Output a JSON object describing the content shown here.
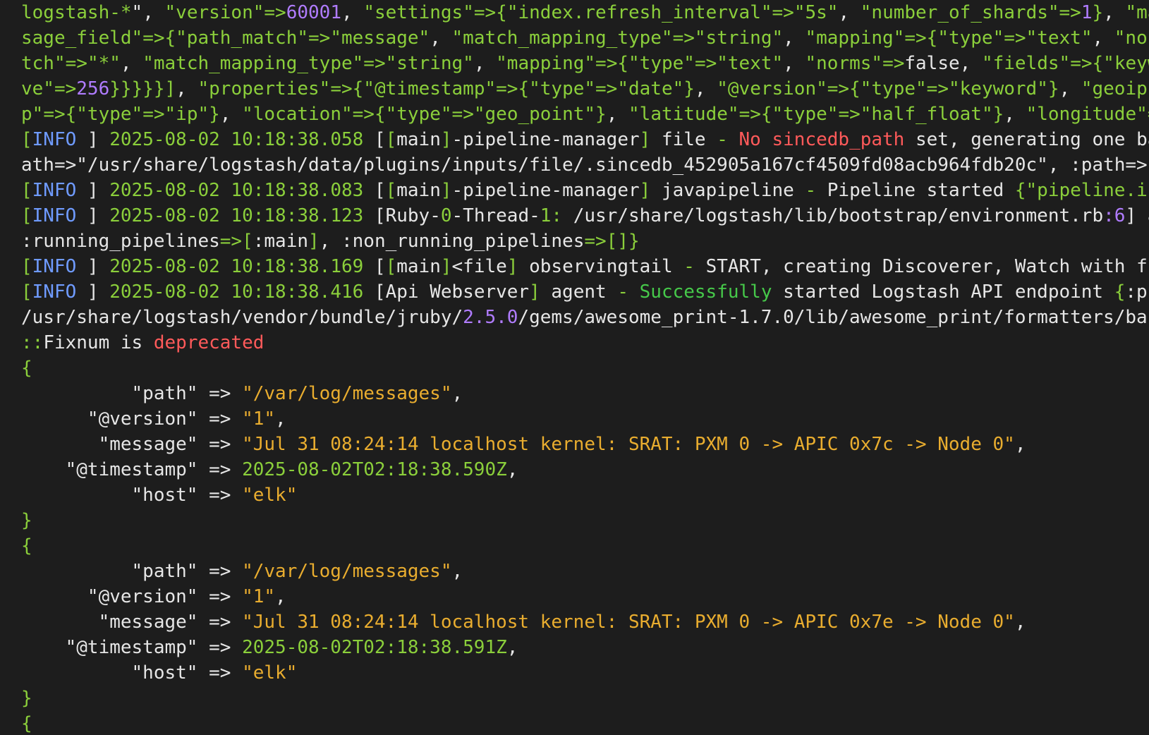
{
  "palette": {
    "background": "#1d1d1d",
    "default": "#e6e6e6",
    "green": "#8bcf3b",
    "blue": "#6f9bff",
    "purple": "#b07cff",
    "red": "#ff5a5a",
    "bright_green": "#46c94a",
    "orange": "#e9ad2f"
  },
  "terminal": {
    "lines": [
      [
        [
          "logstash-*",
          "green"
        ],
        [
          "\", ",
          "default"
        ],
        [
          "\"version\"",
          "green"
        ],
        [
          "=>",
          "green"
        ],
        [
          "60001",
          "purple"
        ],
        [
          ", ",
          "default"
        ],
        [
          "\"settings\"",
          "green"
        ],
        [
          "=>",
          "green"
        ],
        [
          "{",
          "green"
        ],
        [
          "\"index.refresh_interval\"",
          "green"
        ],
        [
          "=>",
          "green"
        ],
        [
          "\"5s\"",
          "green"
        ],
        [
          ", ",
          "default"
        ],
        [
          "\"number_of_shards\"",
          "green"
        ],
        [
          "=>",
          "green"
        ],
        [
          "1",
          "purple"
        ],
        [
          "}",
          "green"
        ],
        [
          ", ",
          "default"
        ],
        [
          "\"ma",
          "green"
        ]
      ],
      [
        [
          "sage_field\"",
          "green"
        ],
        [
          "=>",
          "green"
        ],
        [
          "{",
          "green"
        ],
        [
          "\"path_match\"",
          "green"
        ],
        [
          "=>",
          "green"
        ],
        [
          "\"message\"",
          "green"
        ],
        [
          ", ",
          "default"
        ],
        [
          "\"match_mapping_type\"",
          "green"
        ],
        [
          "=>",
          "green"
        ],
        [
          "\"string\"",
          "green"
        ],
        [
          ", ",
          "default"
        ],
        [
          "\"mapping\"",
          "green"
        ],
        [
          "=>",
          "green"
        ],
        [
          "{",
          "green"
        ],
        [
          "\"type\"",
          "green"
        ],
        [
          "=>",
          "green"
        ],
        [
          "\"text\"",
          "green"
        ],
        [
          ", ",
          "default"
        ],
        [
          "\"nor",
          "green"
        ]
      ],
      [
        [
          "tch\"",
          "green"
        ],
        [
          "=>",
          "green"
        ],
        [
          "\"*\"",
          "green"
        ],
        [
          ", ",
          "default"
        ],
        [
          "\"match_mapping_type\"",
          "green"
        ],
        [
          "=>",
          "green"
        ],
        [
          "\"string\"",
          "green"
        ],
        [
          ", ",
          "default"
        ],
        [
          "\"mapping\"",
          "green"
        ],
        [
          "=>",
          "green"
        ],
        [
          "{",
          "green"
        ],
        [
          "\"type\"",
          "green"
        ],
        [
          "=>",
          "green"
        ],
        [
          "\"text\"",
          "green"
        ],
        [
          ", ",
          "default"
        ],
        [
          "\"norms\"",
          "green"
        ],
        [
          "=>",
          "green"
        ],
        [
          "false",
          "default"
        ],
        [
          ", ",
          "default"
        ],
        [
          "\"fields\"",
          "green"
        ],
        [
          "=>",
          "green"
        ],
        [
          "{",
          "green"
        ],
        [
          "\"keyw",
          "green"
        ]
      ],
      [
        [
          "ve\"",
          "green"
        ],
        [
          "=>",
          "green"
        ],
        [
          "256",
          "purple"
        ],
        [
          "}}}}}]",
          "green"
        ],
        [
          ", ",
          "default"
        ],
        [
          "\"properties\"",
          "green"
        ],
        [
          "=>",
          "green"
        ],
        [
          "{",
          "green"
        ],
        [
          "\"@timestamp\"",
          "green"
        ],
        [
          "=>",
          "green"
        ],
        [
          "{",
          "green"
        ],
        [
          "\"type\"",
          "green"
        ],
        [
          "=>",
          "green"
        ],
        [
          "\"date\"",
          "green"
        ],
        [
          "}",
          "green"
        ],
        [
          ", ",
          "default"
        ],
        [
          "\"@version\"",
          "green"
        ],
        [
          "=>",
          "green"
        ],
        [
          "{",
          "green"
        ],
        [
          "\"type\"",
          "green"
        ],
        [
          "=>",
          "green"
        ],
        [
          "\"keyword\"",
          "green"
        ],
        [
          "}",
          "green"
        ],
        [
          ", ",
          "default"
        ],
        [
          "\"geoip\"",
          "green"
        ]
      ],
      [
        [
          "p\"",
          "green"
        ],
        [
          "=>",
          "green"
        ],
        [
          "{",
          "green"
        ],
        [
          "\"type\"",
          "green"
        ],
        [
          "=>",
          "green"
        ],
        [
          "\"ip\"",
          "green"
        ],
        [
          "}",
          "green"
        ],
        [
          ", ",
          "default"
        ],
        [
          "\"location\"",
          "green"
        ],
        [
          "=>",
          "green"
        ],
        [
          "{",
          "green"
        ],
        [
          "\"type\"",
          "green"
        ],
        [
          "=>",
          "green"
        ],
        [
          "\"geo_point\"",
          "green"
        ],
        [
          "}",
          "green"
        ],
        [
          ", ",
          "default"
        ],
        [
          "\"latitude\"",
          "green"
        ],
        [
          "=>",
          "green"
        ],
        [
          "{",
          "green"
        ],
        [
          "\"type\"",
          "green"
        ],
        [
          "=>",
          "green"
        ],
        [
          "\"half_float\"",
          "green"
        ],
        [
          "}",
          "green"
        ],
        [
          ", ",
          "default"
        ],
        [
          "\"longitude\"",
          "green"
        ],
        [
          "=",
          "green"
        ]
      ],
      [
        [
          "[",
          "green"
        ],
        [
          "INFO ",
          "blue"
        ],
        [
          "] ",
          "default"
        ],
        [
          "2025-08-02 10:18:38.058",
          "green"
        ],
        [
          " [",
          "default"
        ],
        [
          "[",
          "green"
        ],
        [
          "main",
          "default"
        ],
        [
          "]",
          "green"
        ],
        [
          "-pipeline-manager",
          "default"
        ],
        [
          "]",
          "green"
        ],
        [
          " file ",
          "default"
        ],
        [
          "- ",
          "green"
        ],
        [
          "No sincedb_path",
          "red"
        ],
        [
          " set, generating one ba",
          "default"
        ]
      ],
      [
        [
          "ath=>",
          "default"
        ],
        [
          "\"/usr/share/logstash/data/plugins/inputs/file/.sincedb_452905a167cf4509fd08acb964fdb20c\"",
          "default"
        ],
        [
          ", :path=>",
          "default"
        ],
        [
          "[",
          "green"
        ]
      ],
      [
        [
          "[",
          "green"
        ],
        [
          "INFO ",
          "blue"
        ],
        [
          "] ",
          "default"
        ],
        [
          "2025-08-02 10:18:38.083",
          "green"
        ],
        [
          " [",
          "default"
        ],
        [
          "[",
          "green"
        ],
        [
          "main",
          "default"
        ],
        [
          "]",
          "green"
        ],
        [
          "-pipeline-manager",
          "default"
        ],
        [
          "]",
          "green"
        ],
        [
          " javapipeline ",
          "default"
        ],
        [
          "- ",
          "green"
        ],
        [
          "Pipeline started ",
          "default"
        ],
        [
          "{",
          "green"
        ],
        [
          "\"pipeline.ic",
          "green"
        ]
      ],
      [
        [
          "[",
          "green"
        ],
        [
          "INFO ",
          "blue"
        ],
        [
          "] ",
          "default"
        ],
        [
          "2025-08-02 10:18:38.123",
          "green"
        ],
        [
          " [",
          "default"
        ],
        [
          "Ruby-",
          "default"
        ],
        [
          "0",
          "green"
        ],
        [
          "-Thread-",
          "default"
        ],
        [
          "1",
          "green"
        ],
        [
          ":",
          "green"
        ],
        [
          " /usr/share/logstash/lib/bootstrap/environment.rb",
          "default"
        ],
        [
          ":6",
          "purple"
        ],
        [
          "] a",
          "default"
        ]
      ],
      [
        [
          ":running_pipelines",
          "default"
        ],
        [
          "=>",
          "green"
        ],
        [
          "[",
          "green"
        ],
        [
          ":main",
          "default"
        ],
        [
          "]",
          "green"
        ],
        [
          ", ",
          "default"
        ],
        [
          ":non_running_pipelines",
          "default"
        ],
        [
          "=>",
          "green"
        ],
        [
          "[]}",
          "green"
        ]
      ],
      [
        [
          "[",
          "green"
        ],
        [
          "INFO ",
          "blue"
        ],
        [
          "] ",
          "default"
        ],
        [
          "2025-08-02 10:18:38.169",
          "green"
        ],
        [
          " [",
          "default"
        ],
        [
          "[",
          "green"
        ],
        [
          "main",
          "default"
        ],
        [
          "]",
          "green"
        ],
        [
          "<file",
          "default"
        ],
        [
          "]",
          "green"
        ],
        [
          " observingtail ",
          "default"
        ],
        [
          "- ",
          "green"
        ],
        [
          "START, creating Discoverer, Watch with fi",
          "default"
        ]
      ],
      [
        [
          "[",
          "green"
        ],
        [
          "INFO ",
          "blue"
        ],
        [
          "] ",
          "default"
        ],
        [
          "2025-08-02 10:18:38.416",
          "green"
        ],
        [
          " [",
          "default"
        ],
        [
          "Api Webserver",
          "default"
        ],
        [
          "]",
          "green"
        ],
        [
          " agent ",
          "default"
        ],
        [
          "- ",
          "green"
        ],
        [
          "Successfully",
          "bright_green"
        ],
        [
          " started Logstash API endpoint ",
          "default"
        ],
        [
          "{",
          "green"
        ],
        [
          ":pc",
          "default"
        ]
      ],
      [
        [
          "/usr/share/logstash/vendor/bundle/jruby/",
          "default"
        ],
        [
          "2.5.0",
          "purple"
        ],
        [
          "/gems/awesome_print-1.7.0/lib/awesome_print/formatters/bas",
          "default"
        ]
      ],
      [
        [
          "::",
          "green"
        ],
        [
          "Fixnum is ",
          "default"
        ],
        [
          "deprecated",
          "red"
        ]
      ],
      [
        [
          "{",
          "green"
        ]
      ],
      [
        [
          "          \"path\" ",
          "default"
        ],
        [
          "=> ",
          "default"
        ],
        [
          "\"/var/log/messages\"",
          "orange"
        ],
        [
          ",",
          "default"
        ]
      ],
      [
        [
          "      \"@version\" ",
          "default"
        ],
        [
          "=> ",
          "default"
        ],
        [
          "\"1\"",
          "orange"
        ],
        [
          ",",
          "default"
        ]
      ],
      [
        [
          "       \"message\" ",
          "default"
        ],
        [
          "=> ",
          "default"
        ],
        [
          "\"Jul 31 08:24:14 localhost kernel: SRAT: PXM 0 -> APIC 0x7c -> Node 0\"",
          "orange"
        ],
        [
          ",",
          "default"
        ]
      ],
      [
        [
          "    \"@timestamp\" ",
          "default"
        ],
        [
          "=> ",
          "default"
        ],
        [
          "2025-08-02T02:18:38.590Z",
          "green"
        ],
        [
          ",",
          "default"
        ]
      ],
      [
        [
          "          \"host\" ",
          "default"
        ],
        [
          "=> ",
          "default"
        ],
        [
          "\"elk\"",
          "orange"
        ]
      ],
      [
        [
          "}",
          "green"
        ]
      ],
      [
        [
          "{",
          "green"
        ]
      ],
      [
        [
          "          \"path\" ",
          "default"
        ],
        [
          "=> ",
          "default"
        ],
        [
          "\"/var/log/messages\"",
          "orange"
        ],
        [
          ",",
          "default"
        ]
      ],
      [
        [
          "      \"@version\" ",
          "default"
        ],
        [
          "=> ",
          "default"
        ],
        [
          "\"1\"",
          "orange"
        ],
        [
          ",",
          "default"
        ]
      ],
      [
        [
          "       \"message\" ",
          "default"
        ],
        [
          "=> ",
          "default"
        ],
        [
          "\"Jul 31 08:24:14 localhost kernel: SRAT: PXM 0 -> APIC 0x7e -> Node 0\"",
          "orange"
        ],
        [
          ",",
          "default"
        ]
      ],
      [
        [
          "    \"@timestamp\" ",
          "default"
        ],
        [
          "=> ",
          "default"
        ],
        [
          "2025-08-02T02:18:38.591Z",
          "green"
        ],
        [
          ",",
          "default"
        ]
      ],
      [
        [
          "          \"host\" ",
          "default"
        ],
        [
          "=> ",
          "default"
        ],
        [
          "\"elk\"",
          "orange"
        ]
      ],
      [
        [
          "}",
          "green"
        ]
      ],
      [
        [
          "{",
          "green"
        ]
      ]
    ]
  }
}
